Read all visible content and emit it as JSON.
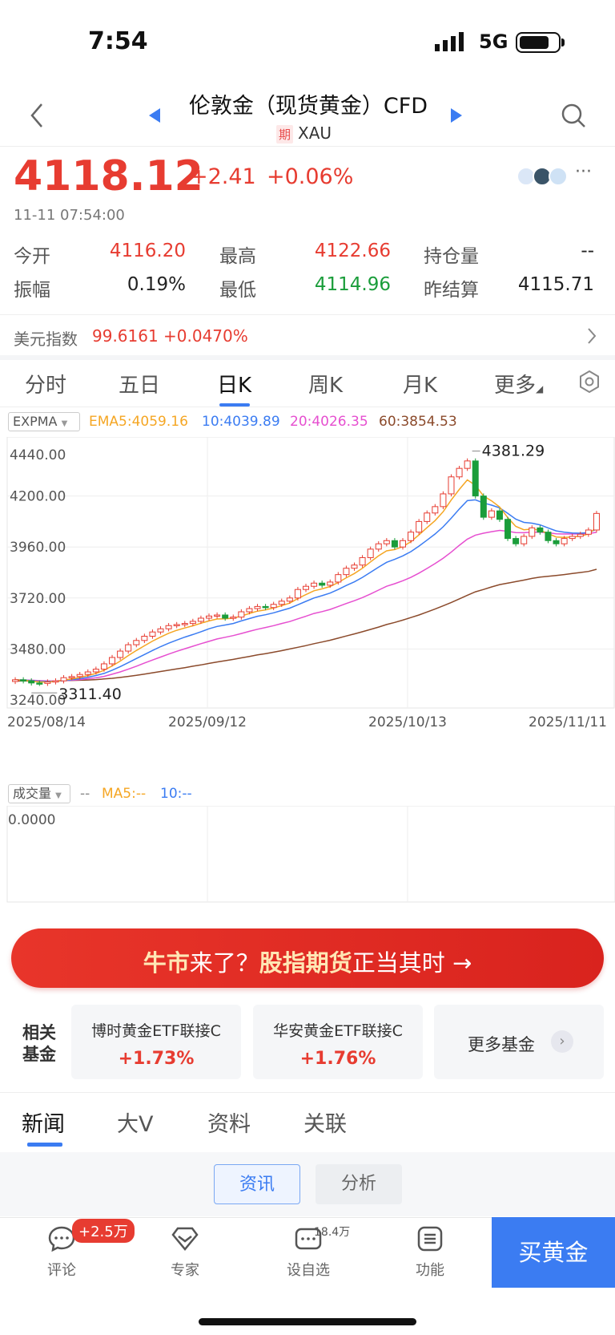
{
  "status": {
    "time": "7:54",
    "network": "5G"
  },
  "nav": {
    "title": "伦敦金（现货黄金）CFD",
    "tag": "期",
    "code": "XAU"
  },
  "quote": {
    "price": "4118.12",
    "change": "+2.41",
    "pct": "+0.06%",
    "time": "11-11 07:54:00",
    "stats": [
      {
        "label": "今开",
        "value": "4116.20",
        "color": "red"
      },
      {
        "label": "最高",
        "value": "4122.66",
        "color": "red"
      },
      {
        "label": "持仓量",
        "value": "--",
        "color": "dark"
      },
      {
        "label": "振幅",
        "value": "0.19%",
        "color": "dark"
      },
      {
        "label": "最低",
        "value": "4114.96",
        "color": "green"
      },
      {
        "label": "昨结算",
        "value": "4115.71",
        "color": "dark"
      }
    ]
  },
  "dollar": {
    "label": "美元指数",
    "value": "99.6161",
    "pct": "+0.0470%"
  },
  "chart_tabs": [
    "分时",
    "五日",
    "日K",
    "周K",
    "月K",
    "更多"
  ],
  "indicator": {
    "name": "EXPMA",
    "ema5": "EMA5:4059.16",
    "ema10": "10:4039.89",
    "ema20": "20:4026.35",
    "ema60": "60:3854.53",
    "colors": {
      "ema5": "#f5a623",
      "ema10": "#3b7cf2",
      "ema20": "#e64fd0",
      "ema60": "#8b4a2b",
      "up": "#e73c31",
      "down": "#1a9d3a"
    }
  },
  "volume": {
    "name": "成交量",
    "dash": "--",
    "ma5": "MA5:--",
    "ma10": "10:--",
    "axis_zero": "0.0000"
  },
  "chart_data": {
    "type": "candlestick",
    "ylabels": [
      "4440.00",
      "4200.00",
      "3960.00",
      "3720.00",
      "3480.00",
      "3240.00"
    ],
    "ylim": [
      3240,
      4440
    ],
    "xlabels": [
      "2025/08/14",
      "2025/09/12",
      "2025/10/13",
      "2025/11/11"
    ],
    "max_label": "4381.29",
    "min_label": "3311.40",
    "closes": [
      3335,
      3330,
      3320,
      3318,
      3325,
      3330,
      3345,
      3350,
      3360,
      3372,
      3385,
      3410,
      3440,
      3470,
      3500,
      3520,
      3540,
      3560,
      3575,
      3590,
      3595,
      3600,
      3610,
      3625,
      3635,
      3640,
      3625,
      3630,
      3655,
      3670,
      3680,
      3675,
      3690,
      3705,
      3720,
      3760,
      3775,
      3790,
      3780,
      3795,
      3830,
      3860,
      3875,
      3910,
      3950,
      3975,
      3990,
      3960,
      3990,
      4030,
      4080,
      4120,
      4150,
      4210,
      4290,
      4330,
      4365,
      4200,
      4100,
      4130,
      4090,
      4000,
      3975,
      4010,
      4050,
      4030,
      3990,
      3975,
      4000,
      4010,
      4020,
      4040,
      4118
    ],
    "ema5": [
      3335,
      3333,
      3329,
      3325,
      3325,
      3327,
      3333,
      3339,
      3346,
      3355,
      3365,
      3380,
      3400,
      3423,
      3449,
      3473,
      3495,
      3517,
      3536,
      3554,
      3568,
      3579,
      3589,
      3601,
      3612,
      3621,
      3622,
      3625,
      3635,
      3647,
      3658,
      3664,
      3673,
      3684,
      3696,
      3717,
      3736,
      3754,
      3763,
      3774,
      3793,
      3815,
      3835,
      3860,
      3890,
      3918,
      3942,
      3948,
      3962,
      3985,
      4017,
      4051,
      4084,
      4126,
      4181,
      4231,
      4276,
      4250,
      4200,
      4177,
      4148,
      4098,
      4057,
      4041,
      4044,
      4039,
      4023,
      4007,
      4005,
      4007,
      4011,
      4021,
      4053
    ],
    "ema10": [
      3335,
      3334,
      3331,
      3328,
      3328,
      3328,
      3331,
      3335,
      3340,
      3347,
      3355,
      3365,
      3380,
      3397,
      3416,
      3435,
      3454,
      3473,
      3491,
      3507,
      3522,
      3536,
      3548,
      3561,
      3575,
      3586,
      3593,
      3600,
      3612,
      3623,
      3634,
      3641,
      3650,
      3661,
      3672,
      3688,
      3704,
      3720,
      3731,
      3743,
      3760,
      3779,
      3796,
      3817,
      3841,
      3865,
      3888,
      3902,
      3918,
      3938,
      3964,
      3992,
      4021,
      4055,
      4096,
      4139,
      4178,
      4182,
      4167,
      4157,
      4144,
      4118,
      4091,
      4076,
      4072,
      4064,
      4050,
      4036,
      4030,
      4026,
      4025,
      4028,
      4044
    ],
    "ema20": [
      3335,
      3334,
      3333,
      3331,
      3330,
      3330,
      3331,
      3333,
      3336,
      3340,
      3344,
      3351,
      3361,
      3372,
      3385,
      3399,
      3414,
      3428,
      3442,
      3456,
      3469,
      3481,
      3493,
      3505,
      3516,
      3527,
      3535,
      3543,
      3553,
      3563,
      3573,
      3581,
      3590,
      3600,
      3609,
      3622,
      3634,
      3647,
      3656,
      3666,
      3680,
      3694,
      3707,
      3722,
      3739,
      3757,
      3775,
      3787,
      3801,
      3817,
      3837,
      3859,
      3882,
      3907,
      3936,
      3968,
      3997,
      4016,
      4025,
      4032,
      4038,
      4034,
      4028,
      4027,
      4030,
      4030,
      4027,
      4022,
      4021,
      4021,
      4021,
      4023,
      4029
    ],
    "ema60": [
      3330,
      3330,
      3330,
      3329,
      3329,
      3330,
      3331,
      3332,
      3333,
      3334,
      3336,
      3339,
      3342,
      3346,
      3351,
      3356,
      3362,
      3368,
      3374,
      3380,
      3386,
      3392,
      3399,
      3405,
      3412,
      3419,
      3425,
      3431,
      3438,
      3445,
      3452,
      3458,
      3465,
      3472,
      3480,
      3488,
      3496,
      3505,
      3513,
      3521,
      3531,
      3541,
      3551,
      3561,
      3572,
      3583,
      3595,
      3605,
      3616,
      3628,
      3640,
      3654,
      3668,
      3683,
      3699,
      3716,
      3733,
      3749,
      3760,
      3772,
      3783,
      3790,
      3797,
      3804,
      3812,
      3818,
      3822,
      3826,
      3830,
      3835,
      3840,
      3845,
      3855
    ]
  },
  "banner": {
    "part1": "牛市",
    "part2": "来了？",
    "part3": "股指期货",
    "part4": "正当其时",
    "arrow": "→"
  },
  "funds": {
    "heading1": "相关",
    "heading2": "基金",
    "items": [
      {
        "name": "博时黄金ETF联接C",
        "pct": "+1.73%"
      },
      {
        "name": "华安黄金ETF联接C",
        "pct": "+1.76%"
      }
    ],
    "more": "更多基金"
  },
  "news_tabs": [
    "新闻",
    "大V",
    "资料",
    "关联"
  ],
  "news_pills": [
    "资讯",
    "分析"
  ],
  "bottom": {
    "comment": "评论",
    "comment_badge": "+2.5万",
    "expert": "专家",
    "watch": "设自选",
    "watch_count": "18.4万",
    "func": "功能",
    "buy": "买黄金"
  }
}
